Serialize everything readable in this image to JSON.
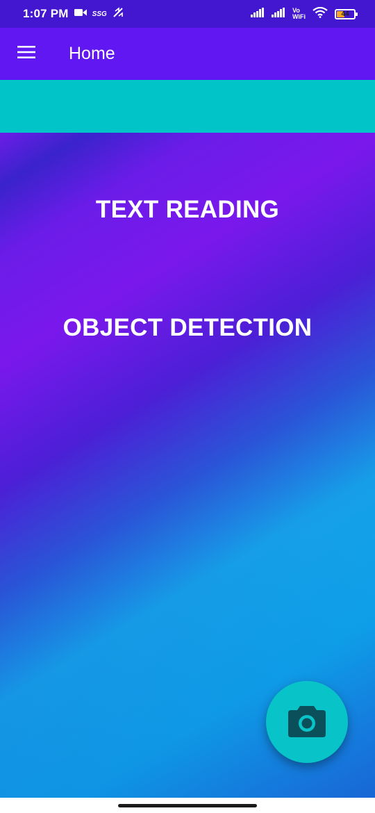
{
  "status_bar": {
    "time": "1:07 PM",
    "carrier_icon_text": "SSG",
    "vowifi_top": "Vo",
    "vowifi_bottom": "WiFi",
    "battery_level": "44",
    "battery_fraction": 0.44,
    "icons": [
      "video-camera-icon",
      "network-speed-icon",
      "signal-icon",
      "signal-icon",
      "wifi-icon",
      "battery-icon"
    ]
  },
  "app_bar": {
    "title": "Home",
    "menu_icon": "hamburger-menu-icon",
    "background": "#6117f2"
  },
  "accent_strip": {
    "background": "#00c4c8"
  },
  "main": {
    "actions": [
      {
        "label": "TEXT READING"
      },
      {
        "label": "OBJECT DETECTION"
      }
    ]
  },
  "fab": {
    "icon": "camera-icon",
    "background": "#08c3c7",
    "icon_color": "#0a4f5a"
  },
  "colors": {
    "status_bar": "#4316cf",
    "gradient_purple": "#7a18ec",
    "gradient_blue": "#0ea3ea"
  }
}
